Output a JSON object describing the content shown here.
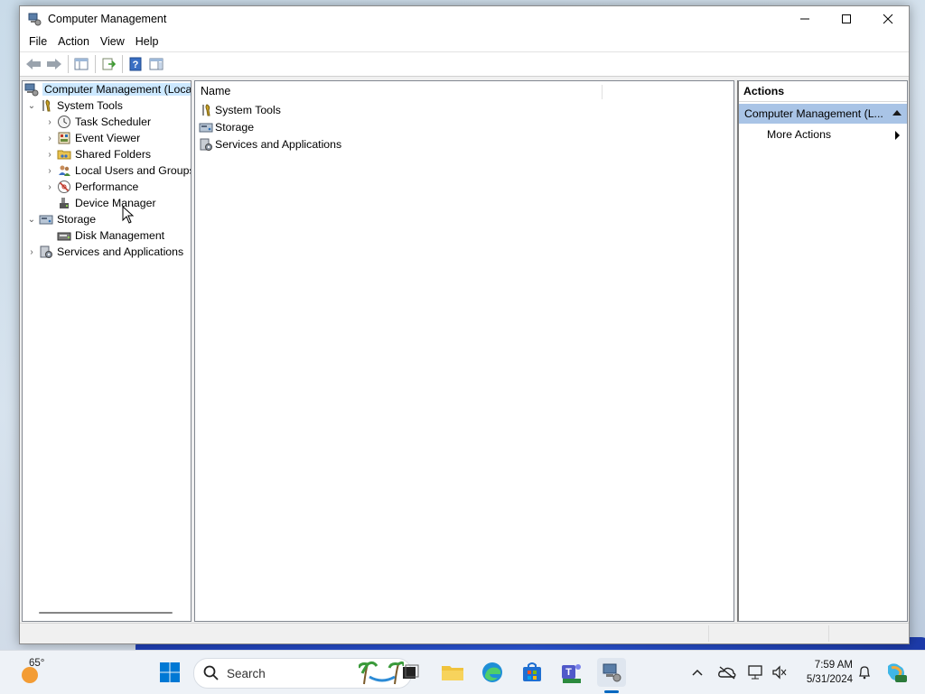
{
  "window": {
    "title": "Computer Management",
    "controls": {
      "minimize": "minimize",
      "maximize": "maximize",
      "close": "close"
    }
  },
  "menu": [
    "File",
    "Action",
    "View",
    "Help"
  ],
  "tree": {
    "root": "Computer Management (Local",
    "items": [
      {
        "label": "System Tools",
        "level": 1,
        "expanded": true,
        "icon": "tools-icon"
      },
      {
        "label": "Task Scheduler",
        "level": 2,
        "expanded": false,
        "icon": "clock-icon"
      },
      {
        "label": "Event Viewer",
        "level": 2,
        "expanded": false,
        "icon": "event-viewer-icon"
      },
      {
        "label": "Shared Folders",
        "level": 2,
        "expanded": false,
        "icon": "shared-folder-icon"
      },
      {
        "label": "Local Users and Groups",
        "level": 2,
        "expanded": false,
        "icon": "users-icon"
      },
      {
        "label": "Performance",
        "level": 2,
        "expanded": false,
        "icon": "performance-icon"
      },
      {
        "label": "Device Manager",
        "level": 2,
        "leaf": true,
        "icon": "device-manager-icon"
      },
      {
        "label": "Storage",
        "level": 1,
        "expanded": true,
        "icon": "storage-icon"
      },
      {
        "label": "Disk Management",
        "level": 2,
        "leaf": true,
        "icon": "disk-icon"
      },
      {
        "label": "Services and Applications",
        "level": 1,
        "expanded": false,
        "icon": "services-icon"
      }
    ]
  },
  "center": {
    "column_header": "Name",
    "rows": [
      {
        "label": "System Tools",
        "icon": "tools-icon"
      },
      {
        "label": "Storage",
        "icon": "storage-icon"
      },
      {
        "label": "Services and Applications",
        "icon": "services-icon"
      }
    ]
  },
  "actions": {
    "header": "Actions",
    "section": "Computer Management (L...",
    "items": [
      "More Actions"
    ]
  },
  "taskbar": {
    "weather_temp": "65°",
    "search_placeholder": "Search",
    "time": "7:59 AM",
    "date": "5/31/2024"
  },
  "colors": {
    "selection": "#cce8ff",
    "actions_section": "#a9c4e6",
    "taskbar": "#eef2f7",
    "accent": "#0067c0"
  }
}
